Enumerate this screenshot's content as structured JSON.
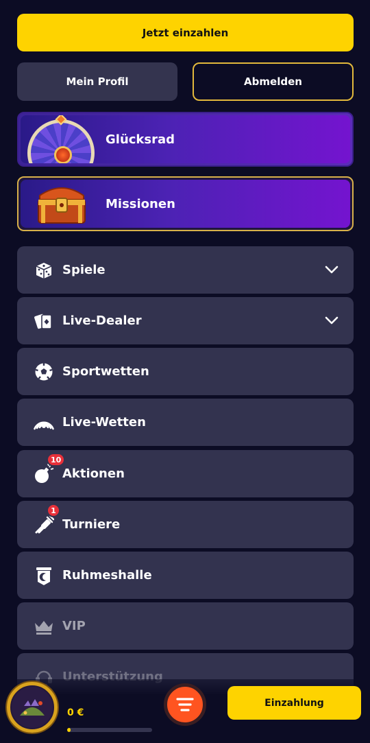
{
  "header": {
    "deposit_label": "Jetzt einzahlen",
    "profile_label": "Mein Profil",
    "logout_label": "Abmelden"
  },
  "promos": {
    "wheel_label": "Glücksrad",
    "missions_label": "Missionen"
  },
  "menu": {
    "items": [
      {
        "label": "Spiele",
        "icon": "dice-icon",
        "expandable": true
      },
      {
        "label": "Live-Dealer",
        "icon": "cards-icon",
        "expandable": true
      },
      {
        "label": "Sportwetten",
        "icon": "soccer-ball-icon",
        "expandable": false
      },
      {
        "label": "Live-Wetten",
        "icon": "live-signal-icon",
        "expandable": false
      },
      {
        "label": "Aktionen",
        "icon": "bomb-icon",
        "badge": "10",
        "expandable": false
      },
      {
        "label": "Turniere",
        "icon": "tournament-icon",
        "badge": "1",
        "expandable": false
      },
      {
        "label": "Ruhmeshalle",
        "icon": "hall-of-fame-icon",
        "expandable": false
      },
      {
        "label": "VIP",
        "icon": "crown-icon",
        "expandable": false
      },
      {
        "label": "Unterstützung",
        "icon": "support-icon",
        "expandable": false
      }
    ]
  },
  "footer": {
    "balance": "0 €",
    "progress": 0.04,
    "deposit_label": "Einzahlung"
  },
  "colors": {
    "accent": "#fed300",
    "background": "#0c0c24",
    "card": "#33334f",
    "fab": "#ff5420",
    "badge": "#e8303a"
  }
}
